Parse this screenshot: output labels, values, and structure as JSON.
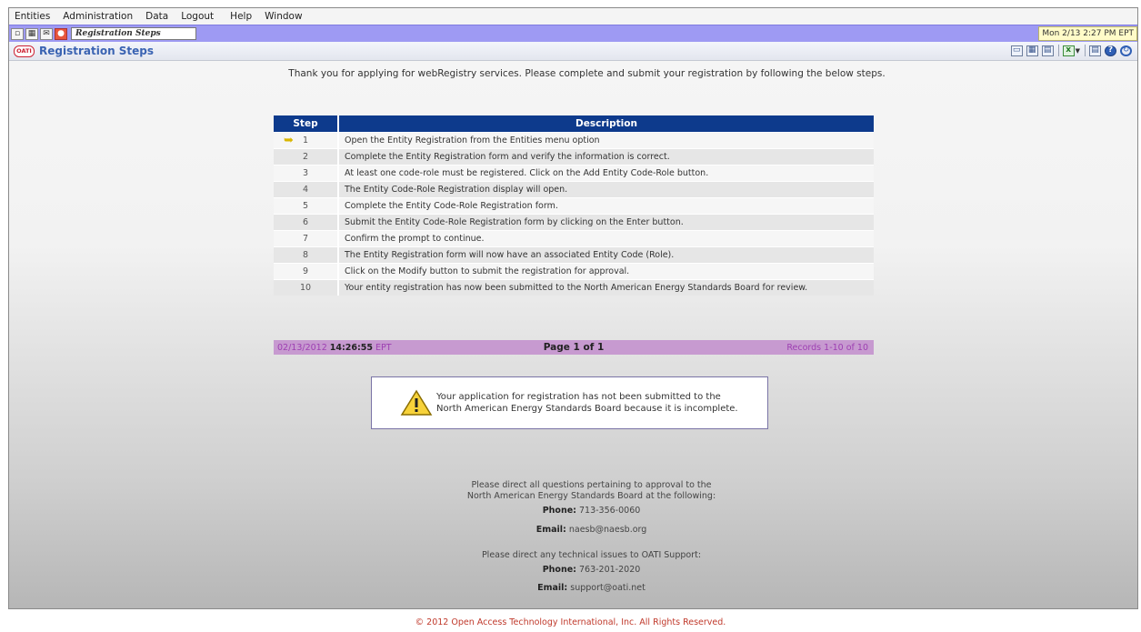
{
  "menu": [
    "Entities",
    "Administration",
    "Data",
    "Logout",
    "Help",
    "Window"
  ],
  "toolbar": {
    "window_tab": "Registration Steps",
    "clock": "Mon 2/13 2:27 PM EPT"
  },
  "header": {
    "logo": "OATI",
    "title": "Registration Steps"
  },
  "intro": "Thank you for applying for webRegistry services. Please complete and submit your registration by following the below steps.",
  "table": {
    "headers": [
      "Step",
      "Description"
    ],
    "rows": [
      {
        "step": "1",
        "desc": "Open the Entity Registration from the Entities menu option"
      },
      {
        "step": "2",
        "desc": "Complete the Entity Registration form and verify the information is correct."
      },
      {
        "step": "3",
        "desc": "At least one code-role must be registered. Click on the Add Entity Code-Role button."
      },
      {
        "step": "4",
        "desc": "The Entity Code-Role Registration display will open."
      },
      {
        "step": "5",
        "desc": "Complete the Entity Code-Role Registration form."
      },
      {
        "step": "6",
        "desc": "Submit the Entity Code-Role Registration form by clicking on the Enter button."
      },
      {
        "step": "7",
        "desc": "Confirm the prompt to continue."
      },
      {
        "step": "8",
        "desc": "The Entity Registration form will now have an associated Entity Code (Role)."
      },
      {
        "step": "9",
        "desc": "Click on the Modify button to submit the registration for approval."
      },
      {
        "step": "10",
        "desc": "Your entity registration has now been submitted to the North American Energy Standards Board for review."
      }
    ],
    "current_step_index": 0,
    "footer": {
      "date": "02/13/2012",
      "time": "14:26:55",
      "tz": "EPT",
      "page": "Page 1 of 1",
      "records": "Records 1-10 of 10"
    }
  },
  "alert": {
    "line1": "Your application for registration has not been submitted to the",
    "line2": "North American Energy Standards Board because it is incomplete."
  },
  "contact": {
    "naesb_line1": "Please direct all questions pertaining to approval to the",
    "naesb_line2": "North American Energy Standards Board at the following:",
    "phone_label": "Phone:",
    "naesb_phone": "713-356-0060",
    "email_label": "Email:",
    "naesb_email": "naesb@naesb.org",
    "oati_line": "Please direct any technical issues to OATI Support:",
    "oati_phone": "763-201-2020",
    "oati_email": "support@oati.net"
  },
  "copyright": "© 2012 Open Access Technology International, Inc. All Rights Reserved.",
  "colors": {
    "header_blue": "#0d3a8c",
    "toolbar_purple": "#9e9af3",
    "footer_pink": "#c79ad0",
    "title_blue": "#3a63b2"
  }
}
